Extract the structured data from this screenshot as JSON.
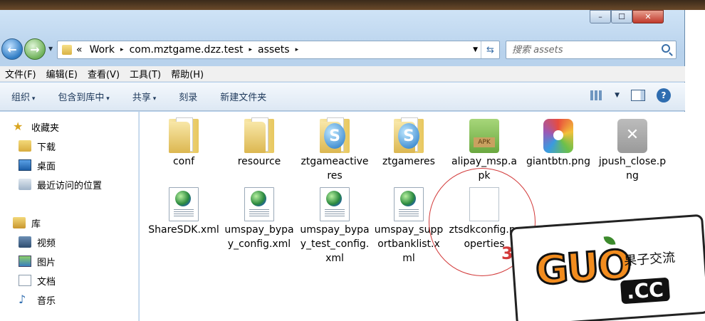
{
  "window": {
    "minimize": "–",
    "maximize": "☐",
    "close": "✕"
  },
  "address": {
    "crumbs": [
      "«",
      "Work",
      "com.mztgame.dzz.test",
      "assets"
    ],
    "chevron": "▸"
  },
  "search": {
    "placeholder": "搜索 assets"
  },
  "menu": [
    "文件(F)",
    "编辑(E)",
    "查看(V)",
    "工具(T)",
    "帮助(H)"
  ],
  "toolbar": {
    "organize": "组织",
    "include": "包含到库中",
    "share": "共享",
    "burn": "刻录",
    "new_folder": "新建文件夹"
  },
  "sidebar": {
    "favorites": "收藏夹",
    "downloads": "下载",
    "desktop": "桌面",
    "recent": "最近访问的位置",
    "libraries": "库",
    "videos": "视频",
    "pictures": "图片",
    "documents": "文档",
    "music": "音乐"
  },
  "files": [
    {
      "name": "conf",
      "icon": "folder-icon"
    },
    {
      "name": "resource",
      "icon": "folder-icon"
    },
    {
      "name": "ztgameactiveres",
      "icon": "folder-s-icon"
    },
    {
      "name": "ztgameres",
      "icon": "folder-s-icon"
    },
    {
      "name": "alipay_msp.apk",
      "icon": "apk-icon"
    },
    {
      "name": "giantbtn.png",
      "icon": "image-icon"
    },
    {
      "name": "jpush_close.png",
      "icon": "close-image-icon"
    },
    {
      "name": "ShareSDK.xml",
      "icon": "xml-icon"
    },
    {
      "name": "umspay_bypay_config.xml",
      "icon": "xml-icon"
    },
    {
      "name": "umspay_bypay_test_config.xml",
      "icon": "xml-icon"
    },
    {
      "name": "umspay_supportbanklist.xml",
      "icon": "xml-icon"
    },
    {
      "name": "ztsdkconfig.properties",
      "icon": "blank-file-icon"
    }
  ],
  "watermark": {
    "main": "GUO",
    "domain": ".CC",
    "tagline": "果子交流",
    "mark": "3"
  }
}
